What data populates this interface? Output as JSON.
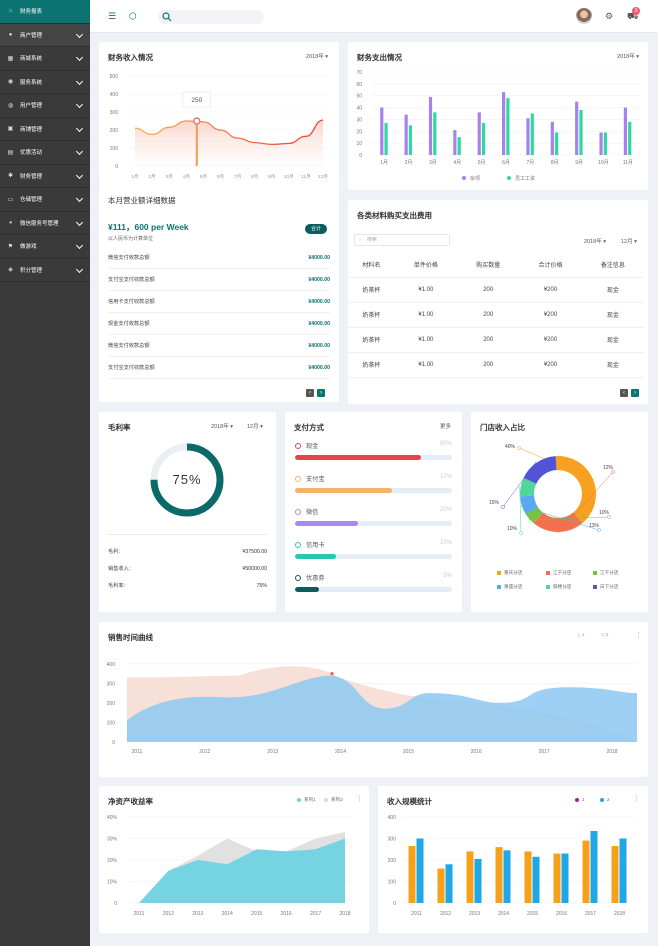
{
  "sidebar": {
    "items": [
      {
        "label": "财务报表",
        "icon": "home-icon",
        "glyph": "⌂"
      },
      {
        "label": "商户管理",
        "icon": "user-icon",
        "glyph": "●"
      },
      {
        "label": "商城系统",
        "icon": "cart-icon",
        "glyph": "▦"
      },
      {
        "label": "服务系统",
        "icon": "chat-icon",
        "glyph": "◉"
      },
      {
        "label": "用户管理",
        "icon": "users-icon",
        "glyph": "◍"
      },
      {
        "label": "商铺管理",
        "icon": "briefcase-icon",
        "glyph": "▣"
      },
      {
        "label": "优惠活动",
        "icon": "ticket-icon",
        "glyph": "▤"
      },
      {
        "label": "财务管理",
        "icon": "gear-icon",
        "glyph": "✱"
      },
      {
        "label": "仓储管理",
        "icon": "box-icon",
        "glyph": "▭"
      },
      {
        "label": "微信服务号管理",
        "icon": "wechat-icon",
        "glyph": "◕"
      },
      {
        "label": "做游戏",
        "icon": "flag-icon",
        "glyph": "⚑"
      },
      {
        "label": "积分管理",
        "icon": "coin-icon",
        "glyph": "◈"
      }
    ]
  },
  "header": {
    "badge": "3",
    "colors": {
      "accent": "#0b7370"
    }
  },
  "income": {
    "title": "财务收入情况",
    "year": "2018年",
    "tooltip": "250",
    "chart_data": {
      "type": "line",
      "categories": [
        "1月",
        "2月",
        "3月",
        "4月",
        "5月",
        "6月",
        "7月",
        "8月",
        "9月",
        "10月",
        "11月",
        "12月"
      ],
      "yticks": [
        0,
        100,
        200,
        300,
        400,
        500
      ],
      "ylim": [
        0,
        500
      ],
      "values": [
        210,
        175,
        215,
        250,
        245,
        200,
        155,
        130,
        120,
        125,
        165,
        255
      ]
    }
  },
  "detail": {
    "title": "本月营业额详细数据",
    "amount": "¥111，600 per Week",
    "unit": "以人民币为计算单位",
    "badge": "合计",
    "rows": [
      {
        "label": "微信支付收款总额",
        "value": "¥4000.00"
      },
      {
        "label": "支付宝支付收款总额",
        "value": "¥4000.00"
      },
      {
        "label": "信用卡支付收款总额",
        "value": "¥4000.00"
      },
      {
        "label": "现金支付收款总额",
        "value": "¥4000.00"
      },
      {
        "label": "微信支付收款总额",
        "value": "¥4000.00"
      },
      {
        "label": "支付宝支付收款总额",
        "value": "¥4000.00"
      }
    ]
  },
  "expense": {
    "title": "财务支出情况",
    "year": "2018年",
    "chart_data": {
      "type": "bar",
      "categories": [
        "1月",
        "2月",
        "3月",
        "4月",
        "5月",
        "6月",
        "7月",
        "8月",
        "9月",
        "10月",
        "11月"
      ],
      "yticks": [
        0,
        10,
        20,
        30,
        40,
        50,
        60,
        70
      ],
      "ylim": [
        0,
        70
      ],
      "series": [
        {
          "name": "杂项",
          "color": "#a782ec",
          "values": [
            40,
            34,
            49,
            21,
            36,
            53,
            31,
            28,
            45,
            19,
            40
          ]
        },
        {
          "name": "员工工资",
          "color": "#2ed8a0",
          "values": [
            27,
            25,
            36,
            15,
            27,
            48,
            35,
            19,
            38,
            19,
            28
          ]
        }
      ]
    }
  },
  "materials": {
    "title": "各类材料购买支出费用",
    "search_placeholder": "搜索",
    "year": "2018年",
    "month": "12月",
    "headers": [
      "材料名",
      "单件价格",
      "购买数量",
      "合计价格",
      "备注信息"
    ],
    "rows": [
      [
        "奶茶杯",
        "¥1.00",
        "200",
        "¥200",
        "现金"
      ],
      [
        "奶茶杯",
        "¥1.00",
        "200",
        "¥200",
        "现金"
      ],
      [
        "奶茶杯",
        "¥1.00",
        "200",
        "¥200",
        "现金"
      ],
      [
        "奶茶杯",
        "¥1.00",
        "200",
        "¥200",
        "现金"
      ]
    ]
  },
  "gross": {
    "title": "毛利率",
    "year": "2018年",
    "month": "12月",
    "percent": "75%",
    "ratio": 0.75,
    "rows": [
      {
        "label": "毛利：",
        "value": "¥37500.00"
      },
      {
        "label": "销售收入：",
        "value": "¥50000.00"
      },
      {
        "label": "毛利率：",
        "value": "75%"
      }
    ]
  },
  "payment": {
    "title": "支付方式",
    "more": "更多",
    "items": [
      {
        "label": "现金",
        "pct": "80%",
        "frac": 0.8,
        "color": "#e8424f"
      },
      {
        "label": "支付宝",
        "pct": "12%",
        "frac": 0.62,
        "color": "#f9b366"
      },
      {
        "label": "微信",
        "pct": "20%",
        "frac": 0.4,
        "color": "#a78bec"
      },
      {
        "label": "信用卡",
        "pct": "10%",
        "frac": 0.26,
        "color": "#2ac6b0"
      },
      {
        "label": "优惠券",
        "pct": "5%",
        "frac": 0.15,
        "color": "#0b5e5c"
      }
    ]
  },
  "store": {
    "title": "门店收入占比",
    "chart_data": {
      "type": "pie",
      "slices": [
        {
          "label": "重庆分店",
          "value": 40,
          "pct": "40%",
          "color": "#f7a021"
        },
        {
          "label": "江宁分店",
          "value": 22,
          "pct": "12%",
          "color": "#f5704f"
        },
        {
          "label": "江干分店",
          "value": 5,
          "pct": "10%",
          "color": "#7ac143"
        },
        {
          "label": "重盛分店",
          "value": 8,
          "pct": "13%",
          "color": "#5aa9f0"
        },
        {
          "label": "鼓楼分店",
          "value": 8,
          "pct": "10%",
          "color": "#4fd69a"
        },
        {
          "label": "白下分店",
          "value": 17,
          "pct": "15%",
          "color": "#5353d8"
        }
      ]
    }
  },
  "sales": {
    "title": "销售时间曲线",
    "legend": [
      "1",
      "2"
    ],
    "chart_data": {
      "type": "area",
      "categories": [
        "2011",
        "2012",
        "2013",
        "2014",
        "2015",
        "2016",
        "2017",
        "2018"
      ],
      "yticks": [
        0,
        100,
        200,
        300,
        400
      ],
      "ylim": [
        0,
        430
      ],
      "series": [
        {
          "name": "1",
          "color": "#f6ddd3"
        },
        {
          "name": "2",
          "color": "#8cc8f2"
        }
      ]
    }
  },
  "roe": {
    "title": "净资产收益率",
    "legend": [
      "系列1",
      "系列2"
    ],
    "chart_data": {
      "type": "area",
      "categories": [
        "2011",
        "2012",
        "2013",
        "2014",
        "2015",
        "2016",
        "2017",
        "2018"
      ],
      "yticks": [
        "0",
        "10%",
        "20%",
        "30%",
        "40%"
      ],
      "ylim": [
        0,
        40
      ],
      "series": [
        {
          "name": "系列1",
          "color": "#6fd2e2",
          "values": [
            0,
            15,
            20,
            18,
            25,
            24,
            25,
            30
          ]
        },
        {
          "name": "系列2",
          "color": "#d9d9d9",
          "values": [
            0,
            15,
            22,
            30,
            24,
            24,
            30,
            33
          ]
        }
      ]
    }
  },
  "scale": {
    "title": "收入规模统计",
    "legend": [
      "1",
      "2"
    ],
    "chart_data": {
      "type": "bar",
      "categories": [
        "2011",
        "2012",
        "2013",
        "2014",
        "2015",
        "2016",
        "2017",
        "2018"
      ],
      "yticks": [
        0,
        100,
        200,
        300,
        400
      ],
      "ylim": [
        0,
        400
      ],
      "series": [
        {
          "name": "1",
          "color": "#f7a11b",
          "values": [
            265,
            160,
            240,
            260,
            240,
            230,
            290,
            265
          ]
        },
        {
          "name": "2",
          "color": "#1fa7e8",
          "values": [
            300,
            180,
            205,
            245,
            215,
            230,
            335,
            300
          ]
        }
      ]
    }
  }
}
